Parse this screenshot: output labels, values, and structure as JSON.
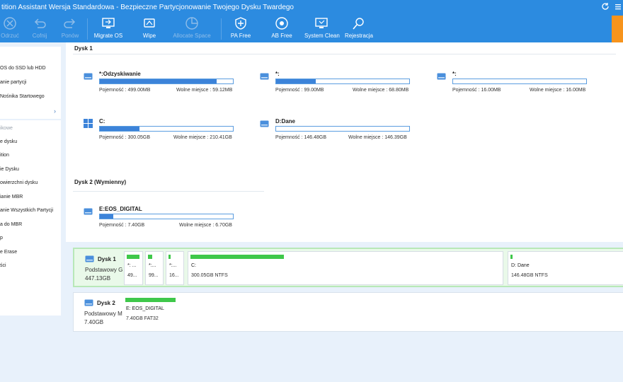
{
  "window": {
    "title": "tition Assistant Wersja Standardowa - Bezpieczne Partycjonowanie Twojego Dysku Twardego"
  },
  "toolbar": {
    "items": [
      {
        "label": "Odrzuć",
        "icon": "discard-icon",
        "enabled": false
      },
      {
        "label": "Cofnij",
        "icon": "undo-icon",
        "enabled": false
      },
      {
        "label": "Ponów",
        "icon": "redo-icon",
        "enabled": false
      },
      {
        "label": "Migrate OS",
        "icon": "migrate-os-icon",
        "enabled": true
      },
      {
        "label": "Wipe",
        "icon": "wipe-icon",
        "enabled": true
      },
      {
        "label": "Allocate Space",
        "icon": "allocate-space-icon",
        "enabled": false
      },
      {
        "label": "PA Free",
        "icon": "pa-free-icon",
        "enabled": true
      },
      {
        "label": "AB Free",
        "icon": "ab-free-icon",
        "enabled": true
      },
      {
        "label": "System Clean",
        "icon": "system-clean-icon",
        "enabled": true
      },
      {
        "label": "Rejestracja",
        "icon": "registration-icon",
        "enabled": true
      }
    ]
  },
  "sidebar": {
    "wizard_items": [
      "OS do SSD lub HDD",
      "anie partycji",
      "Nośnika Startowego"
    ],
    "more_arrow": "›",
    "section_title": "ikowe",
    "operations": [
      "e dysku",
      "ition",
      "ie Dysku",
      "owierzchni dysku",
      "ianie MBR",
      "anie Wszystkich Partycji",
      "a do MBR",
      "p",
      "e Erase",
      "ści"
    ]
  },
  "disk1": {
    "title": "Dysk 1",
    "partitions": [
      {
        "name": "*:Odzyskiwanie",
        "cap_label": "Pojemność : 499.00MB",
        "free_label": "Wolne miejsce : 59.12MB",
        "used": 0.88,
        "icon": "drive-icon"
      },
      {
        "name": "*:",
        "cap_label": "Pojemność : 99.00MB",
        "free_label": "Wolne miejsce : 68.80MB",
        "used": 0.3,
        "icon": "drive-icon"
      },
      {
        "name": "*:",
        "cap_label": "Pojemność : 16.00MB",
        "free_label": "Wolne miejsce : 16.00MB",
        "used": 0.0,
        "icon": "drive-icon"
      },
      {
        "name": "C:",
        "cap_label": "Pojemność : 300.05GB",
        "free_label": "Wolne miejsce : 210.41GB",
        "used": 0.3,
        "icon": "windows-icon"
      },
      {
        "name": "D:Dane",
        "cap_label": "Pojemność : 146.48GB",
        "free_label": "Wolne miejsce : 146.39GB",
        "used": 0.0,
        "icon": "drive-icon"
      }
    ]
  },
  "disk2": {
    "title": "Dysk 2 (Wymienny)",
    "partitions": [
      {
        "name": "E:EOS_DIGITAL",
        "cap_label": "Pojemność : 7.40GB",
        "free_label": "Wolne miejsce : 6.70GB",
        "used": 0.1,
        "icon": "drive-icon"
      }
    ]
  },
  "diskmap": [
    {
      "name": "Dysk 1",
      "type": "Podstawowy G",
      "size": "447.13GB",
      "selected": true,
      "parts": [
        {
          "name": "*: ...",
          "size": "49...",
          "used": 0.88
        },
        {
          "name": "*:...",
          "size": "99...",
          "used": 0.3
        },
        {
          "name": "*:...",
          "size": "16...",
          "used": 0.0
        },
        {
          "name": "C:",
          "size": "300.05GB NTFS",
          "used": 0.3
        },
        {
          "name": "D: Dane",
          "size": "146.48GB NTFS",
          "used": 0.0
        }
      ]
    },
    {
      "name": "Dysk 2",
      "type": "Podstawowy M",
      "size": "7.40GB",
      "selected": false,
      "parts": [
        {
          "name": "E: EOS_DIGITAL",
          "size": "7.40GB FAT32",
          "used": 0.1
        }
      ]
    }
  ],
  "colors": {
    "accent": "#2c8be0",
    "bar": "#3c83d9",
    "map_bar": "#3fc84a",
    "upgrade": "#f7941d"
  }
}
